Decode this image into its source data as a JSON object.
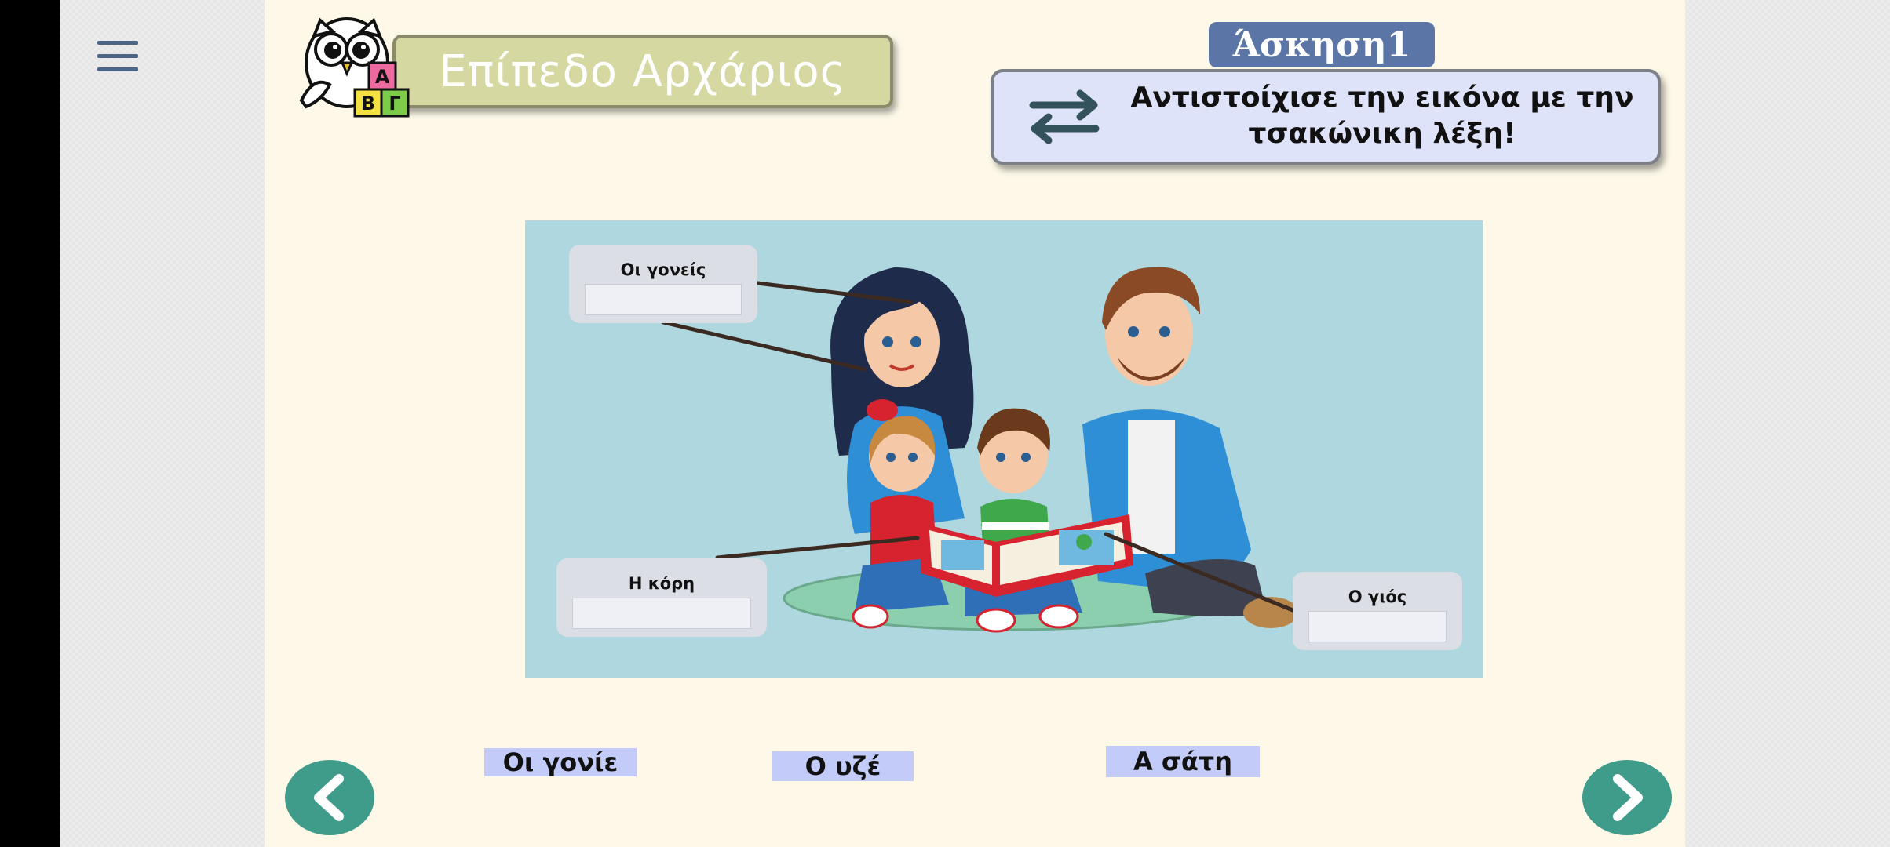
{
  "header": {
    "level_title": "Επίπεδο Αρχάριος",
    "logo_letters": [
      "A",
      "B",
      "Γ"
    ]
  },
  "exercise": {
    "title": "Άσκηση1",
    "instruction": "Αντιστοίχισε την εικόνα με την τσακώνικη λέξη!"
  },
  "scene": {
    "labels": [
      {
        "text": "Οι γονείς"
      },
      {
        "text": "Η κόρη"
      },
      {
        "text": "Ο γιός"
      }
    ]
  },
  "words": [
    "Οι γονίε",
    "Ο υζέ",
    "Α σάτη"
  ],
  "nav": {
    "prev_icon": "chevron-left-icon",
    "next_icon": "chevron-right-icon",
    "menu_icon": "hamburger-menu-icon"
  },
  "colors": {
    "page_bg": "#fdf8e8",
    "accent_teal": "#3f9c8b",
    "title_blue": "#5a75a6",
    "banner_green": "#d6d8a2",
    "word_bg": "#c3cbf9",
    "scene_bg": "#aed7df"
  }
}
